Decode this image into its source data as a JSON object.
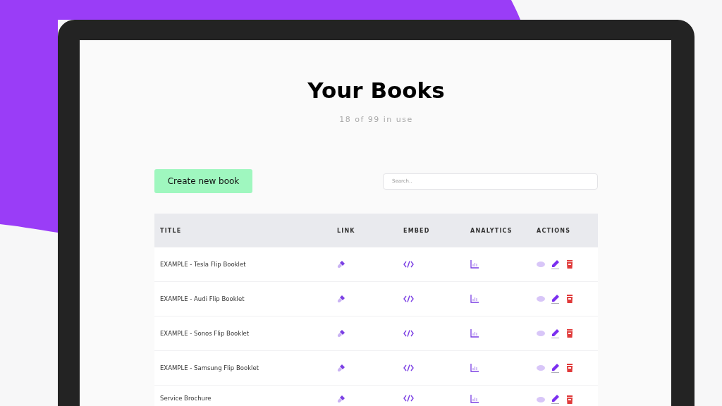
{
  "page": {
    "title": "Your Books",
    "subtitle": "18 of 99 in use"
  },
  "toolbar": {
    "create_button": "Create new book",
    "search": {
      "placeholder": "Search.."
    }
  },
  "table": {
    "columns": [
      "TITLE",
      "LINK",
      "EMBED",
      "ANALYTICS",
      "ACTIONS"
    ],
    "rows": [
      {
        "title": "EXAMPLE - Tesla Flip Booklet"
      },
      {
        "title": "EXAMPLE - Audi Flip Booklet"
      },
      {
        "title": "EXAMPLE - Sonos Flip Booklet"
      },
      {
        "title": "EXAMPLE - Samsung Flip Booklet"
      },
      {
        "title": "Service Brochure"
      }
    ]
  }
}
